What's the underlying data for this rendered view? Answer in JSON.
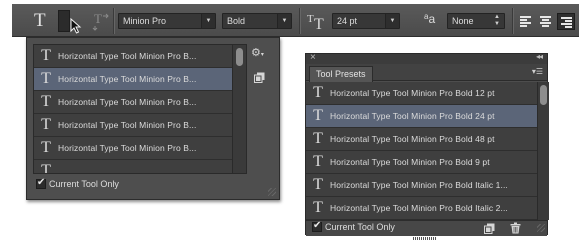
{
  "options_bar": {
    "tool_glyph": "T",
    "preset_picker_icon": "tool-preset-picker-icon",
    "orientation_icon": "toggle-text-orientation-icon",
    "font_family": {
      "value": "Minion Pro"
    },
    "font_style": {
      "value": "Bold"
    },
    "size_icon": "font-size-icon",
    "font_size": {
      "value": "24 pt"
    },
    "antialias_icon_text": "a",
    "antialias_icon_text2": "a",
    "antialias": {
      "value": "None"
    },
    "align_icons": [
      "align-left-icon",
      "align-center-icon",
      "align-right-icon"
    ]
  },
  "preset_dropdown": {
    "items": [
      {
        "glyph": "T",
        "label": "Horizontal Type Tool Minion Pro B..."
      },
      {
        "glyph": "T",
        "label": "Horizontal Type Tool Minion Pro B..."
      },
      {
        "glyph": "T",
        "label": "Horizontal Type Tool Minion Pro B..."
      },
      {
        "glyph": "T",
        "label": "Horizontal Type Tool Minion Pro B..."
      },
      {
        "glyph": "T",
        "label": "Horizontal Type Tool Minion Pro B..."
      },
      {
        "glyph": "T",
        "label": ""
      }
    ],
    "selected_index": 1,
    "current_tool_only": "Current Tool Only"
  },
  "tool_presets_panel": {
    "title": "Tool Presets",
    "close_glyph": "×",
    "collapse_glyph": "◂◂",
    "items": [
      {
        "glyph": "T",
        "label": "Horizontal Type Tool Minion Pro Bold 12 pt"
      },
      {
        "glyph": "T",
        "label": "Horizontal Type Tool Minion Pro Bold 24 pt"
      },
      {
        "glyph": "T",
        "label": "Horizontal Type Tool Minion Pro Bold 48 pt"
      },
      {
        "glyph": "T",
        "label": "Horizontal Type Tool Minion Pro Bold 9 pt"
      },
      {
        "glyph": "T",
        "label": "Horizontal Type Tool Minion Pro Bold Italic 1..."
      },
      {
        "glyph": "T",
        "label": "Horizontal Type Tool Minion Pro Bold Italic 2..."
      }
    ],
    "selected_index": 1,
    "current_tool_only": "Current Tool Only"
  },
  "colors": {
    "selection": "#5b6578",
    "panel_bg": "#4e4e4e",
    "list_bg": "#3f3f3f"
  }
}
